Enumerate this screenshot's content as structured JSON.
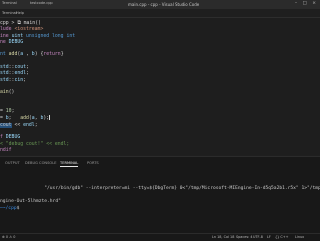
{
  "titlebar": {
    "left_label": "Terminal",
    "tab_name": "testcode.cpp",
    "title": "main.cpp - cpp - Visual Studio Code",
    "controls": "– □ ×"
  },
  "menubar": {
    "items": [
      "Terminal",
      "Help"
    ]
  },
  "editor": {
    "lines": [
      {
        "num": "1",
        "parts": [
          [
            "pl",
            "cpp > ⧉ main()"
          ]
        ]
      },
      {
        "num": "2",
        "parts": [
          [
            "pp",
            "lude "
          ],
          [
            "str",
            "<iostream>"
          ]
        ]
      },
      {
        "num": "3",
        "parts": [
          [
            "kw",
            "ine "
          ],
          [
            "id",
            "uint "
          ],
          [
            "kw2",
            "unsigned long int"
          ]
        ]
      },
      {
        "num": "4",
        "parts": [
          [
            "kw",
            "ne "
          ],
          [
            "id",
            "DEBUG"
          ]
        ]
      },
      {
        "num": "5",
        "parts": [
          [
            "pl",
            ""
          ]
        ]
      },
      {
        "num": "6",
        "parts": [
          [
            "kw2",
            "nt "
          ],
          [
            "fn",
            "add"
          ],
          [
            "pl",
            "("
          ],
          [
            "id",
            "a"
          ],
          [
            "pl",
            " , "
          ],
          [
            "id",
            "b"
          ],
          [
            "pl",
            ") {"
          ],
          [
            "kw",
            "return"
          ],
          [
            "pl",
            "}"
          ]
        ]
      },
      {
        "num": "7",
        "parts": [
          [
            "pl",
            ""
          ]
        ]
      },
      {
        "num": "8",
        "parts": [
          [
            "id",
            "std"
          ],
          [
            "pl",
            "::"
          ],
          [
            "id",
            "cout"
          ],
          [
            "pl",
            ";"
          ]
        ]
      },
      {
        "num": "9",
        "parts": [
          [
            "id",
            "std"
          ],
          [
            "pl",
            "::"
          ],
          [
            "id",
            "endl"
          ],
          [
            "pl",
            ";"
          ]
        ]
      },
      {
        "num": "10",
        "parts": [
          [
            "id",
            "std"
          ],
          [
            "pl",
            "::"
          ],
          [
            "id",
            "cin"
          ],
          [
            "pl",
            ";"
          ]
        ]
      },
      {
        "num": "11",
        "parts": [
          [
            "pl",
            ""
          ]
        ]
      },
      {
        "num": "12",
        "parts": [
          [
            "fn",
            "ain"
          ],
          [
            "pl",
            "()"
          ]
        ]
      },
      {
        "num": "13",
        "parts": [
          [
            "pl",
            ""
          ]
        ]
      },
      {
        "num": "14",
        "parts": [
          [
            "pl",
            ""
          ]
        ]
      },
      {
        "num": "15",
        "parts": [
          [
            "pl",
            "= "
          ],
          [
            "num",
            "10"
          ],
          [
            "pl",
            ";"
          ]
        ]
      },
      {
        "num": "16",
        "parts": [
          [
            "pl",
            "= "
          ],
          [
            "id",
            "b"
          ],
          [
            "pl",
            ";   "
          ],
          [
            "fn",
            "add"
          ],
          [
            "pl",
            "("
          ],
          [
            "id",
            "a"
          ],
          [
            "pl",
            ", "
          ],
          [
            "id",
            "b"
          ],
          [
            "pl",
            ");"
          ]
        ]
      },
      {
        "num": "17",
        "parts": [
          [
            "sel",
            "cout"
          ],
          [
            "pl",
            " << "
          ],
          [
            "id",
            "endl"
          ],
          [
            "pl",
            ";"
          ]
        ]
      },
      {
        "num": "18",
        "parts": [
          [
            "pl",
            ""
          ]
        ]
      },
      {
        "num": "19",
        "parts": [
          [
            "kw",
            "f "
          ],
          [
            "id",
            "DEBUG"
          ]
        ]
      },
      {
        "num": "20",
        "parts": [
          [
            "cm",
            "< \"debug cout!\" << endl;"
          ]
        ]
      },
      {
        "num": "21",
        "parts": [
          [
            "kw",
            "ndif"
          ]
        ]
      }
    ]
  },
  "panel": {
    "tabs": [
      "OUTPUT",
      "DEBUG CONSOLE",
      "TERMINAL",
      "PORTS"
    ],
    "active_tab": "TERMINAL",
    "terminal_lines": [
      "",
      "",
      "                \"/usr/bin/gdb\" --interpreter=mi --tty=${DbgTerm} 0<\"/tmp/Microsoft-MIEngine-In-d5q5a2b1.r5x\" 1>\"/tmp",
      "",
      "ngine-Out-5lhmzte.hrd\""
    ],
    "prompt_user": "",
    "prompt_path": "─~/cpp",
    "prompt_suffix": "$ "
  },
  "statusbar": {
    "left": "⊗ 0 ⚠ 0",
    "position": "Ln 18, Col 18",
    "spaces": "Spaces: 4",
    "encoding": "UTF-8",
    "eol": "LF",
    "language": "{} C++",
    "platform": "Linux"
  }
}
